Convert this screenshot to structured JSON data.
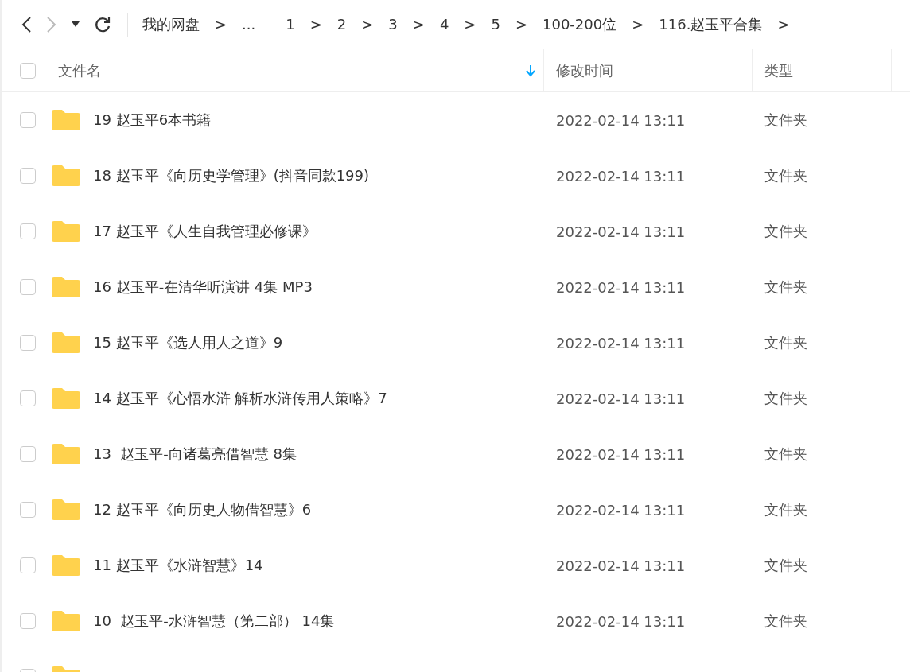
{
  "toolbar": {
    "breadcrumbs": [
      {
        "label": "我的网盘",
        "sep": ">"
      },
      {
        "label": "..."
      },
      {
        "label": "1",
        "sep": ">"
      },
      {
        "label": "2",
        "sep": ">"
      },
      {
        "label": "3",
        "sep": ">"
      },
      {
        "label": "4",
        "sep": ">"
      },
      {
        "label": "5",
        "sep": ">"
      },
      {
        "label": "100-200位",
        "sep": ">"
      },
      {
        "label": "116.赵玉平合集",
        "sep": ">"
      }
    ]
  },
  "table": {
    "select_all": {
      "checked": false
    },
    "partial_row": {
      "checked": false
    },
    "columns": [
      {
        "label": "文件名",
        "sorted": true
      },
      {
        "label": "修改时间",
        "sorted": false
      },
      {
        "label": "类型",
        "sorted": false
      }
    ],
    "rows": [
      {
        "name": "19 赵玉平6本书籍",
        "modified": "2022-02-14 13:11",
        "type": "文件夹",
        "checked": false
      },
      {
        "name": "18 赵玉平《向历史学管理》(抖音同款199)",
        "modified": "2022-02-14 13:11",
        "type": "文件夹",
        "checked": false
      },
      {
        "name": "17 赵玉平《人生自我管理必修课》",
        "modified": "2022-02-14 13:11",
        "type": "文件夹",
        "checked": false
      },
      {
        "name": "16 赵玉平-在清华听演讲 4集 MP3",
        "modified": "2022-02-14 13:11",
        "type": "文件夹",
        "checked": false
      },
      {
        "name": "15 赵玉平《选人用人之道》9",
        "modified": "2022-02-14 13:11",
        "type": "文件夹",
        "checked": false
      },
      {
        "name": "14 赵玉平《心悟水浒 解析水浒传用人策略》7",
        "modified": "2022-02-14 13:11",
        "type": "文件夹",
        "checked": false
      },
      {
        "name": "13  赵玉平-向诸葛亮借智慧 8集",
        "modified": "2022-02-14 13:11",
        "type": "文件夹",
        "checked": false
      },
      {
        "name": "12 赵玉平《向历史人物借智慧》6",
        "modified": "2022-02-14 13:11",
        "type": "文件夹",
        "checked": false
      },
      {
        "name": "11 赵玉平《水浒智慧》14",
        "modified": "2022-02-14 13:11",
        "type": "文件夹",
        "checked": false
      },
      {
        "name": "10  赵玉平-水浒智慧（第二部） 14集",
        "modified": "2022-02-14 13:11",
        "type": "文件夹",
        "checked": false
      }
    ]
  }
}
